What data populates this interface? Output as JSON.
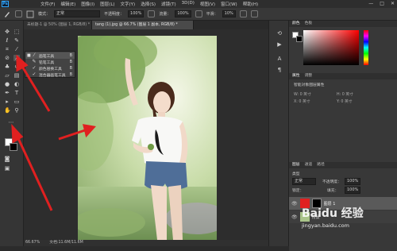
{
  "menubar": {
    "logo": "Ps",
    "items": [
      "文件(F)",
      "编辑(E)",
      "图像(I)",
      "图层(L)",
      "文字(Y)",
      "选择(S)",
      "滤镜(T)",
      "3D(D)",
      "视图(V)",
      "窗口(W)",
      "帮助(H)"
    ],
    "controls": [
      "—",
      "□",
      "✕"
    ]
  },
  "options": {
    "mode_label": "模式：",
    "mode_value": "正常",
    "opacity_label": "不透明度：",
    "opacity_value": "100%",
    "flow_label": "流量：",
    "flow_value": "100%",
    "smooth_label": "平滑：",
    "smooth_value": "10%"
  },
  "tabs": [
    {
      "label": "未标题-1 @ 50% (图层 1, RGB/8) *",
      "active": false
    },
    {
      "label": "tang (1).jpg @ 66.7% (图层 1 副本, RGB/8) *",
      "active": true
    }
  ],
  "flyout": {
    "items": [
      {
        "mark": "■",
        "label": "画笔工具",
        "shortcut": "B",
        "icon": "brush-icon"
      },
      {
        "mark": "",
        "label": "铅笔工具",
        "shortcut": "B",
        "icon": "pencil-icon"
      },
      {
        "mark": "",
        "label": "颜色替换工具",
        "shortcut": "B",
        "icon": "color-replace-icon"
      },
      {
        "mark": "",
        "label": "混合器画笔工具",
        "shortcut": "B",
        "icon": "mixer-brush-icon"
      }
    ]
  },
  "status": {
    "zoom": "66.67%",
    "doc": "文档:11.6M/11.6M"
  },
  "panels": {
    "color_tabs": [
      "颜色",
      "色板"
    ],
    "properties_tabs": [
      "属性",
      "调整"
    ],
    "properties_title": "智能对象图层属性",
    "w_label": "W: 0 英寸",
    "h_label": "H: 0 英寸",
    "x_label": "X: 0 英寸",
    "y_label": "Y: 0 英寸",
    "layer_tabs": [
      "图层",
      "通道",
      "路径"
    ],
    "kind_label": "类型",
    "blend_mode": "正常",
    "opacity_label": "不透明度：",
    "opacity_value": "100%",
    "lock_label": "锁定：",
    "fill_label": "填充：",
    "fill_value": "100%",
    "layers": [
      {
        "name": "图层 1",
        "selected": true
      },
      {
        "name": "背景",
        "selected": false
      }
    ]
  },
  "watermark": {
    "text": "Baidu 经验",
    "url": "jingyan.baidu.com"
  },
  "colors": {
    "accent_arrow": "#e02020",
    "fg_color": "#ffffff",
    "bg_color": "#000000",
    "selected_layer": "#5a5a5a"
  }
}
